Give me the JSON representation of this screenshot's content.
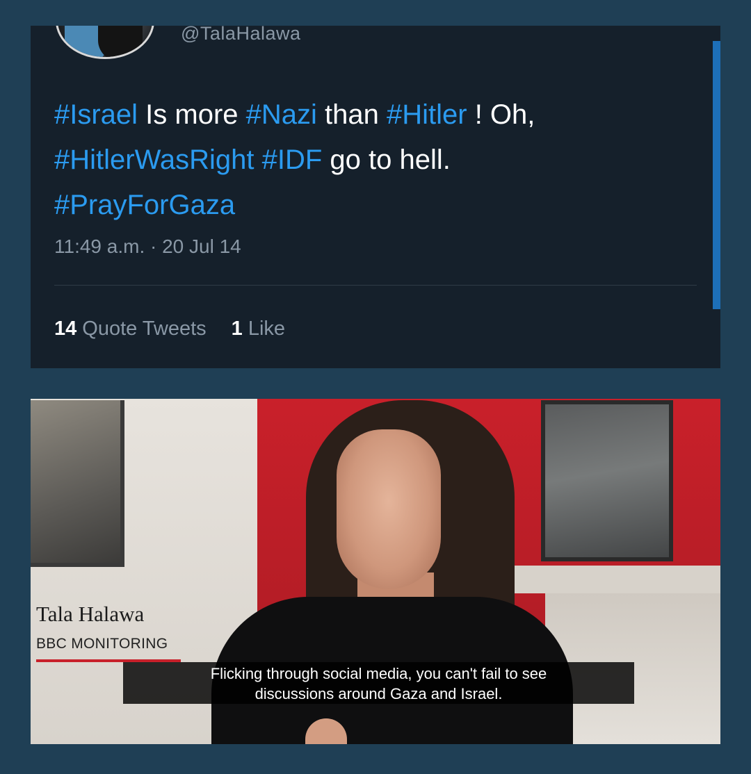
{
  "tweet": {
    "handle": "@TalaHalawa",
    "text_segments": [
      {
        "text": "#Israel",
        "hashtag": true
      },
      {
        "text": " Is more ",
        "hashtag": false
      },
      {
        "text": "#Nazi",
        "hashtag": true
      },
      {
        "text": " than ",
        "hashtag": false
      },
      {
        "text": "#Hitler",
        "hashtag": true
      },
      {
        "text": " ! Oh, ",
        "hashtag": false
      },
      {
        "text": "#HitlerWasRight",
        "hashtag": true
      },
      {
        "text": " ",
        "hashtag": false
      },
      {
        "text": "#IDF",
        "hashtag": true
      },
      {
        "text": " go to hell. ",
        "hashtag": false
      },
      {
        "text": "#PrayForGaza",
        "hashtag": true
      }
    ],
    "timestamp": "11:49 a.m. · 20 Jul 14",
    "stats": {
      "quote_count": "14",
      "quote_label": "Quote Tweets",
      "like_count": "1",
      "like_label": "Like"
    }
  },
  "video": {
    "name_caption": "Tala Halawa",
    "org_caption": "BBC MONITORING",
    "subtitle_line1": "Flicking through social media, you can't fail to see",
    "subtitle_line2": "discussions around Gaza and Israel."
  },
  "colors": {
    "background": "#1f3f55",
    "tweet_bg": "#15202b",
    "hashtag": "#2b9bf0",
    "muted_text": "#8a98a6",
    "accent_red": "#c8202a"
  }
}
